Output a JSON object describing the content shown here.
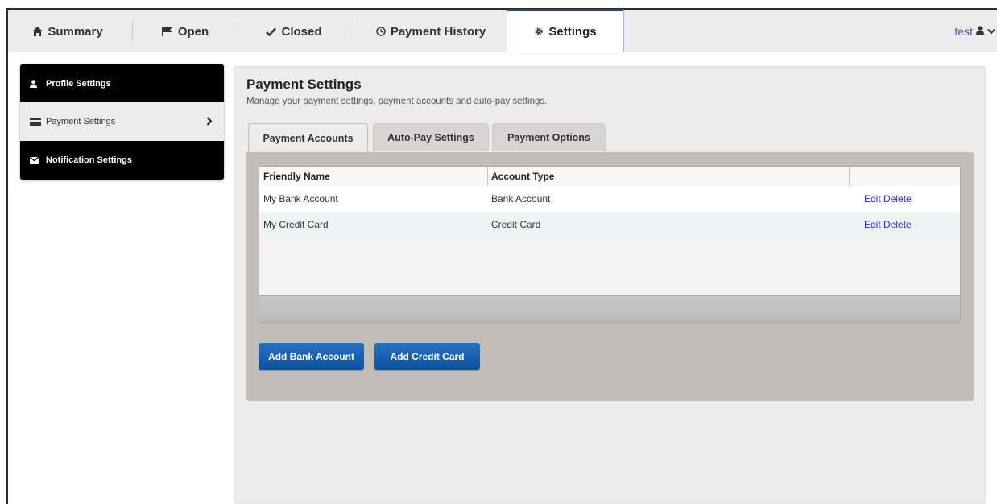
{
  "nav": {
    "tabs": [
      {
        "label": "Summary",
        "icon": "home-icon"
      },
      {
        "label": "Open",
        "icon": "flag-icon"
      },
      {
        "label": "Closed",
        "icon": "check-icon"
      },
      {
        "label": "Payment History",
        "icon": "clock-icon"
      },
      {
        "label": "Settings",
        "icon": "gear-icon"
      }
    ],
    "active_tab": "Settings",
    "user_label": "test"
  },
  "sidebar": {
    "items": [
      {
        "label": "Profile Settings",
        "icon": "user-icon"
      },
      {
        "label": "Payment Settings",
        "icon": "credit-card-icon"
      },
      {
        "label": "Notification Settings",
        "icon": "envelope-icon"
      }
    ],
    "selected": "Payment Settings"
  },
  "main": {
    "title": "Payment Settings",
    "subtitle": "Manage your payment settings, payment accounts and auto-pay settings.",
    "tabs": [
      {
        "label": "Payment Accounts"
      },
      {
        "label": "Auto-Pay Settings"
      },
      {
        "label": "Payment Options"
      }
    ],
    "active_tab": "Payment Accounts",
    "table": {
      "columns": [
        "Friendly Name",
        "Account Type",
        ""
      ],
      "rows": [
        {
          "name": "My Bank Account",
          "type": "Bank Account",
          "edit": "Edit",
          "delete": "Delete"
        },
        {
          "name": "My Credit Card",
          "type": "Credit Card",
          "edit": "Edit",
          "delete": "Delete"
        }
      ]
    },
    "buttons": {
      "add_bank": "Add Bank Account",
      "add_card": "Add Credit Card"
    }
  },
  "colors": {
    "accent": "#1e4c9a",
    "button": "#0c4f9e",
    "link": "#2233cc",
    "panel": "#c3bdba"
  }
}
